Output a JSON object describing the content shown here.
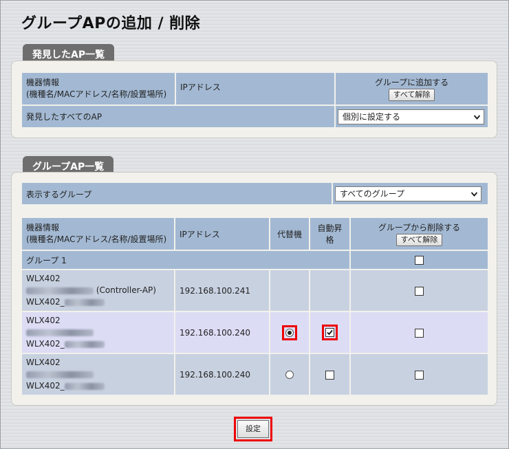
{
  "page": {
    "title": "グループAPの追加 / 削除"
  },
  "discovered": {
    "tab": "発見したAP一覧",
    "col_device_line1": "機器情報",
    "col_device_line2": "(機種名/MACアドレス/名称/設置場所)",
    "col_ip": "IPアドレス",
    "col_add": "グループに追加する",
    "clear_all": "すべて解除",
    "all_ap_label": "発見したすべてのAP",
    "all_ap_select": "個別に設定する"
  },
  "group": {
    "tab": "グループAP一覧",
    "display_label": "表示するグループ",
    "display_select": "すべてのグループ",
    "col_device_line1": "機器情報",
    "col_device_line2": "(機種名/MACアドレス/名称/設置場所)",
    "col_ip": "IPアドレス",
    "col_alt": "代替機",
    "col_promote": "自動昇格",
    "col_delete": "グループから削除する",
    "clear_all": "すべて解除",
    "group_name": "グループ 1",
    "rows": [
      {
        "model": "WLX402",
        "suffix": "(Controller-AP)",
        "name_prefix": "WLX402_",
        "ip": "192.168.100.241",
        "alt_selected": false,
        "promote_checked": false,
        "delete_checked": false
      },
      {
        "model": "WLX402",
        "suffix": "",
        "name_prefix": "WLX402_",
        "ip": "192.168.100.240",
        "alt_selected": true,
        "promote_checked": true,
        "delete_checked": false
      },
      {
        "model": "WLX402",
        "suffix": "",
        "name_prefix": "WLX402_",
        "ip": "192.168.100.240",
        "alt_selected": false,
        "promote_checked": false,
        "delete_checked": false
      }
    ]
  },
  "submit": {
    "label": "設定"
  },
  "colors": {
    "header": "#a3b9d3",
    "row": "#c8d1e0",
    "highlight_row": "#dcdcf5",
    "marker": "#e00000"
  }
}
